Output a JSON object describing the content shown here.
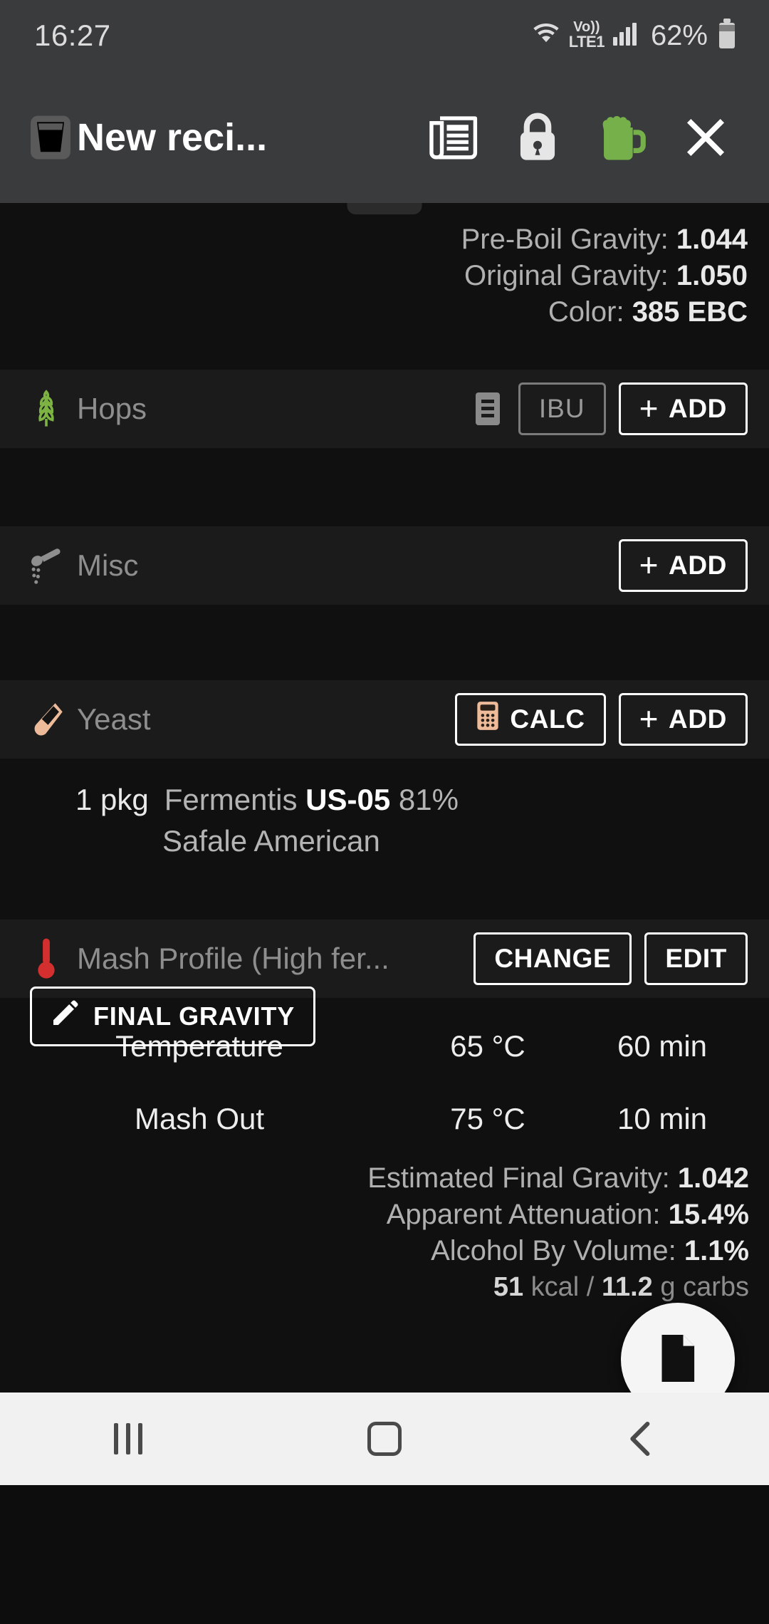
{
  "status_bar": {
    "time": "16:27",
    "wifi_icon": "wifi-icon",
    "volte_top": "Vo))",
    "volte_bottom": "LTE1",
    "signal_icon": "cellular-signal-icon",
    "battery_percent": "62%",
    "battery_icon": "battery-icon"
  },
  "app_bar": {
    "recipe_icon": "beer-glass-icon",
    "title": "New reci...",
    "actions": [
      {
        "name": "news-icon",
        "label": "News"
      },
      {
        "name": "lock-icon",
        "label": "Lock"
      },
      {
        "name": "beer-mug-icon",
        "label": "Brew"
      },
      {
        "name": "close-icon",
        "label": "Close"
      }
    ]
  },
  "stats_top": [
    {
      "label": "Pre-Boil Gravity:",
      "value": "1.044"
    },
    {
      "label": "Original Gravity:",
      "value": "1.050"
    },
    {
      "label": "Color:",
      "value": "385 EBC"
    }
  ],
  "sections": {
    "hops": {
      "icon": "hop-cone-icon",
      "title": "Hops",
      "list_icon": "hop-list-icon",
      "ibu_label": "IBU",
      "add_label": "ADD"
    },
    "misc": {
      "icon": "spoon-icon",
      "title": "Misc",
      "add_label": "ADD"
    },
    "yeast": {
      "icon": "test-tube-icon",
      "title": "Yeast",
      "calc_icon": "calculator-icon",
      "calc_label": "CALC",
      "add_label": "ADD",
      "item": {
        "amount": "1 pkg",
        "brand": "Fermentis",
        "code": "US-05",
        "attenuation": "81%",
        "subtitle": "Safale American"
      }
    },
    "mash": {
      "icon": "thermometer-icon",
      "title": "Mash Profile (High fer...",
      "change_label": "CHANGE",
      "edit_label": "EDIT",
      "steps": [
        {
          "name": "Temperature",
          "temp": "65 °C",
          "time": "60 min"
        },
        {
          "name": "Mash Out",
          "temp": "75 °C",
          "time": "10 min"
        }
      ]
    }
  },
  "stats_bottom": [
    {
      "label": "Estimated Final Gravity:",
      "value": "1.042"
    },
    {
      "label": "Apparent Attenuation:",
      "value": "15.4%"
    },
    {
      "label": "Alcohol By Volume:",
      "value": "1.1%"
    }
  ],
  "nutrition": {
    "kcal_value": "51",
    "kcal_unit": "kcal /",
    "carbs_value": "11.2",
    "carbs_unit": "g carbs"
  },
  "final_gravity_button": {
    "icon": "pencil-icon",
    "label": "FINAL GRAVITY"
  },
  "fab": {
    "icon": "document-icon"
  },
  "nav_bar": {
    "recents": "recents-icon",
    "home": "home-icon",
    "back": "back-icon"
  },
  "colors": {
    "accent_green": "#76b04a",
    "yeast_peach": "#edbb9a",
    "thermometer_red": "#d32f2f",
    "app_bar_bg": "#3a3b3d",
    "content_bg": "#101010",
    "section_bg": "#1b1b1b"
  }
}
